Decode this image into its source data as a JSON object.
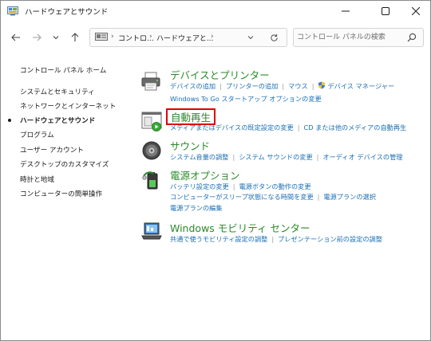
{
  "window": {
    "title": "ハードウェアとサウンド",
    "min_glyph": "—",
    "max_glyph": "▢",
    "close_glyph": "✕"
  },
  "nav": {
    "breadcrumb": [
      "コントロ...",
      "ハードウェアと..."
    ],
    "separator": "›",
    "search_placeholder": "コントロール パネルの検索"
  },
  "sidebar": {
    "items": [
      {
        "label": "コントロール パネル ホーム"
      },
      {
        "label": "システムとセキュリティ"
      },
      {
        "label": "ネットワークとインターネット"
      },
      {
        "label": "ハードウェアとサウンド"
      },
      {
        "label": "プログラム"
      },
      {
        "label": "ユーザー アカウント"
      },
      {
        "label": "デスクトップのカスタマイズ"
      },
      {
        "label": "時計と地域"
      },
      {
        "label": "コンピューターの簡単操作"
      }
    ],
    "current_index": 3
  },
  "categories": [
    {
      "title": "デバイスとプリンター",
      "icon": "printer-icon",
      "rows": [
        [
          "デバイスの追加",
          "プリンターの追加",
          "マウス",
          "デバイス マネージャー"
        ],
        [
          "Windows To Go スタートアップ オプションの変更"
        ]
      ]
    },
    {
      "title": "自動再生",
      "icon": "autoplay-icon",
      "rows": [
        [
          "メディアまたはデバイスの既定設定の変更",
          "CD または他のメディアの自動再生"
        ]
      ]
    },
    {
      "title": "サウンド",
      "icon": "speaker-icon",
      "rows": [
        [
          "システム音量の調整",
          "システム サウンドの変更",
          "オーディオ デバイスの管理"
        ]
      ]
    },
    {
      "title": "電源オプション",
      "icon": "power-options-icon",
      "rows": [
        [
          "バッテリ設定の変更",
          "電源ボタンの動作の変更"
        ],
        [
          "コンピューターがスリープ状態になる時間を変更",
          "電源プランの選択"
        ],
        [
          "電源プランの編集"
        ]
      ]
    },
    {
      "title": "Windows モビリティ センター",
      "icon": "mobility-center-icon",
      "rows": [
        [
          "共通で使うモビリティ設定の調整",
          "プレゼンテーション前の設定の調整"
        ]
      ]
    }
  ],
  "colors": {
    "category_title": "#2a8a2a",
    "task_link": "#1a6fb5",
    "highlight": "#e00000"
  }
}
